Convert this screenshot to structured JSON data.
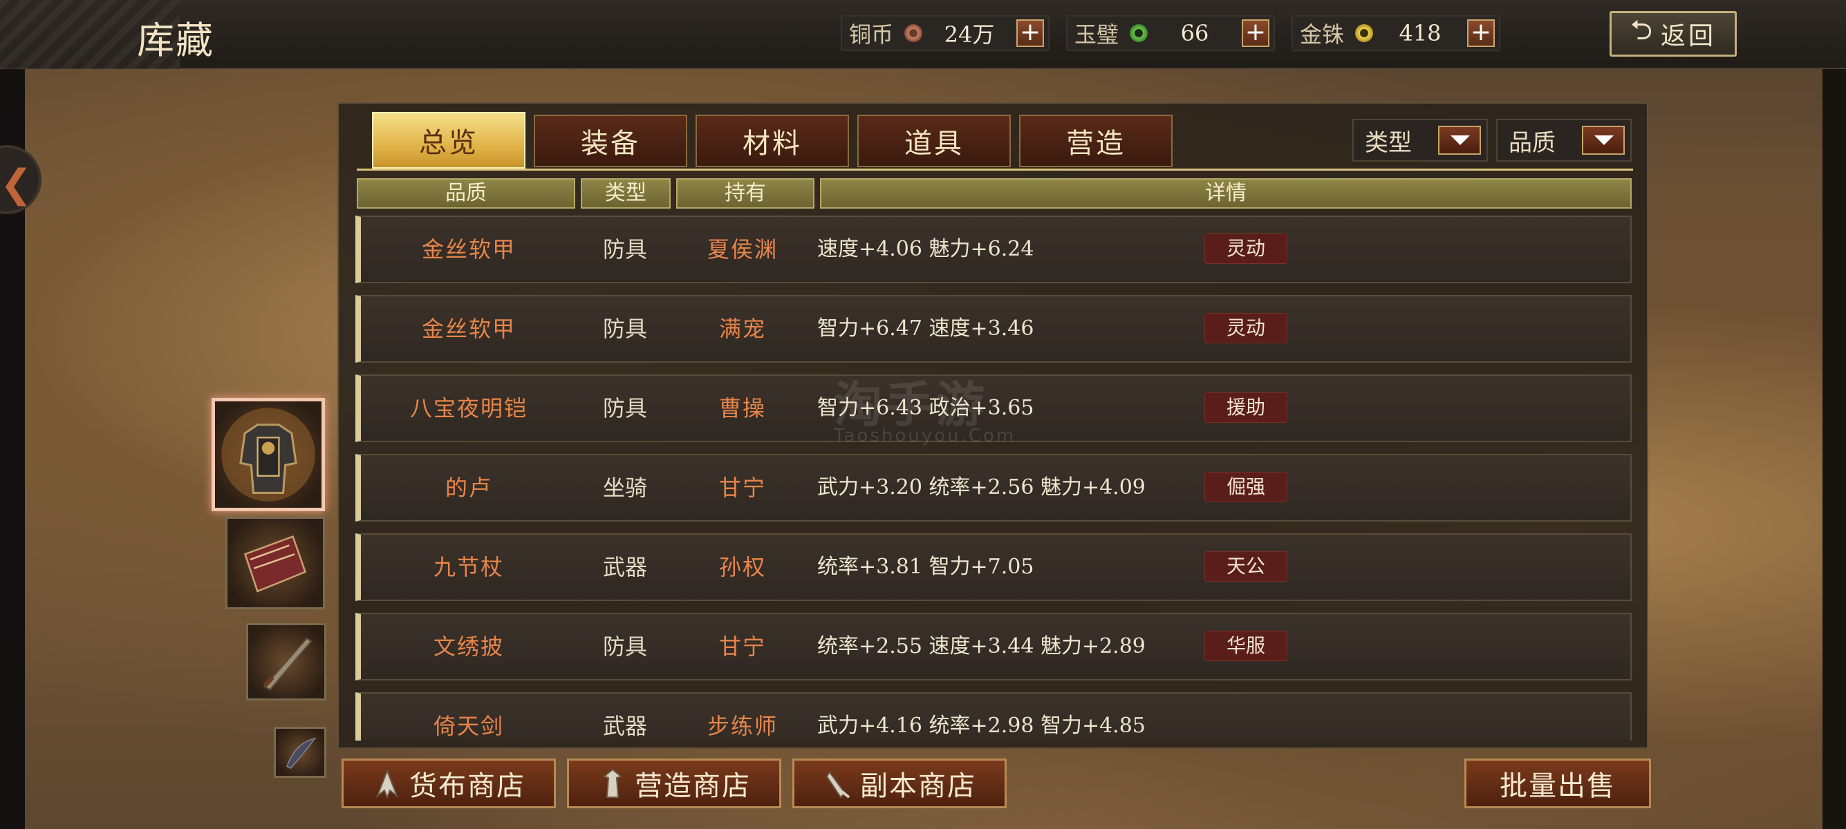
{
  "header": {
    "title": "库藏",
    "back_label": "返回",
    "back_icon": "return-arrow-icon"
  },
  "currencies": [
    {
      "label": "铜币",
      "value": "24万",
      "icon": "copper-coin-icon",
      "color": "#c88466"
    },
    {
      "label": "玉璧",
      "value": "66",
      "icon": "jade-disc-icon",
      "color": "#6cc24a"
    },
    {
      "label": "金铢",
      "value": "418",
      "icon": "gold-coin-icon",
      "color": "#f0d248"
    }
  ],
  "tabs": [
    {
      "label": "总览",
      "active": true
    },
    {
      "label": "装备",
      "active": false
    },
    {
      "label": "材料",
      "active": false
    },
    {
      "label": "道具",
      "active": false
    },
    {
      "label": "营造",
      "active": false
    }
  ],
  "filters": [
    {
      "label": "类型"
    },
    {
      "label": "品质"
    }
  ],
  "table": {
    "headers": [
      "品质",
      "类型",
      "持有",
      "详情"
    ],
    "rows": [
      {
        "name": "金丝软甲",
        "type": "防具",
        "owner": "夏侯渊",
        "stats": "速度+4.06  魅力+6.24",
        "tag": "灵动"
      },
      {
        "name": "金丝软甲",
        "type": "防具",
        "owner": "满宠",
        "stats": "智力+6.47  速度+3.46",
        "tag": "灵动"
      },
      {
        "name": "八宝夜明铠",
        "type": "防具",
        "owner": "曹操",
        "stats": "智力+6.43  政治+3.65",
        "tag": "援助"
      },
      {
        "name": "的卢",
        "type": "坐骑",
        "owner": "甘宁",
        "stats": "武力+3.20  统率+2.56  魅力+4.09",
        "tag": "倔强"
      },
      {
        "name": "九节杖",
        "type": "武器",
        "owner": "孙权",
        "stats": "统率+3.81  智力+7.05",
        "tag": "天公"
      },
      {
        "name": "文绣披",
        "type": "防具",
        "owner": "甘宁",
        "stats": "统率+2.55  速度+3.44  魅力+2.89",
        "tag": "华服"
      },
      {
        "name": "倚天剑",
        "type": "武器",
        "owner": "步练师",
        "stats": "武力+4.16  统率+2.98  智力+4.85",
        "tag": ""
      }
    ]
  },
  "side_items": [
    {
      "icon": "armor-icon",
      "selected": true
    },
    {
      "icon": "banner-icon",
      "selected": false
    },
    {
      "icon": "sword-icon",
      "selected": false
    },
    {
      "icon": "feather-icon",
      "selected": false
    }
  ],
  "bottom_buttons": [
    {
      "label": "货布商店",
      "icon": "spade-coin-icon"
    },
    {
      "label": "营造商店",
      "icon": "tower-icon"
    },
    {
      "label": "副本商店",
      "icon": "scroll-icon"
    }
  ],
  "batch_sell_label": "批量出售",
  "watermark": {
    "main": "淘手游",
    "sub": "Taoshouyou.Com"
  }
}
